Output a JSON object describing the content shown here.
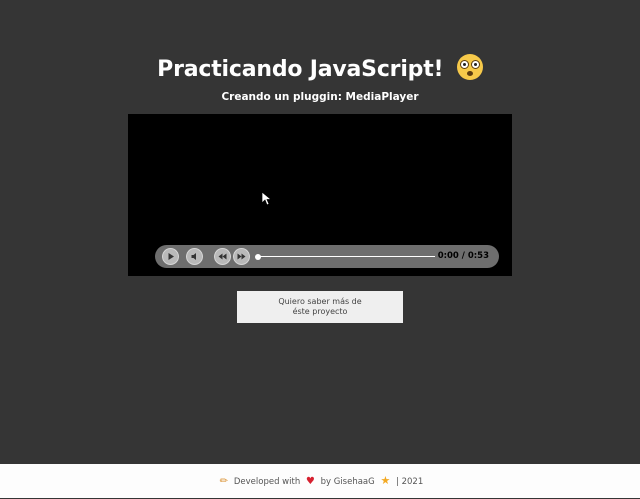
{
  "header": {
    "title": "Practicando JavaScript!",
    "subtitle": "Creando un pluggin: MediaPlayer"
  },
  "player": {
    "time_label": "0:00 / 0:53",
    "progress": 0.0,
    "controls": [
      "play-icon",
      "volume-icon",
      "rewind-icon",
      "fast-forward-icon"
    ]
  },
  "info_button": {
    "line1": "Quiero saber más de",
    "line2": "éste proyecto"
  },
  "footer": {
    "developed_with": "Developed with",
    "by": "by GisehaaG",
    "separator": "|",
    "year": "2021"
  },
  "colors": {
    "page_bg": "#353535",
    "footer_bg": "#fdfdfd",
    "heart": "#d6202f",
    "star": "#f3a922"
  }
}
